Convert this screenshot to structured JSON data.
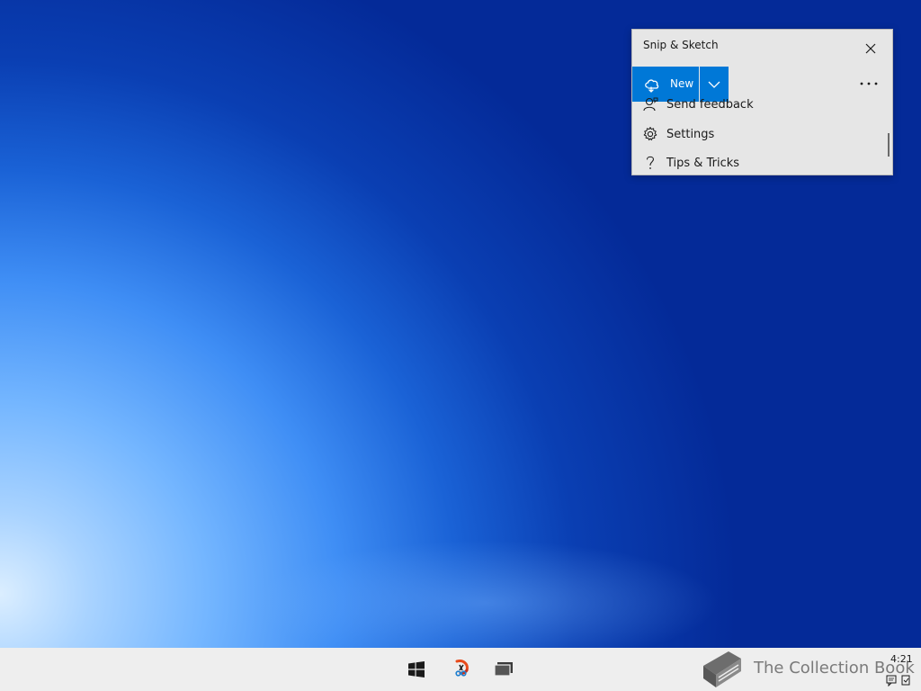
{
  "window": {
    "title": "Snip & Sketch",
    "new_label": "New",
    "menu_items": [
      {
        "label": "Send feedback",
        "icon": "feedback-icon"
      },
      {
        "label": "Settings",
        "icon": "gear-icon"
      },
      {
        "label": "Tips & Tricks",
        "icon": "question-icon"
      }
    ],
    "accent_color": "#0078d7"
  },
  "taskbar": {
    "icons": [
      "windows-start-icon",
      "snip-sketch-app-icon",
      "task-view-icon"
    ],
    "watermark": "The Collection Book",
    "clock": "4:21"
  }
}
